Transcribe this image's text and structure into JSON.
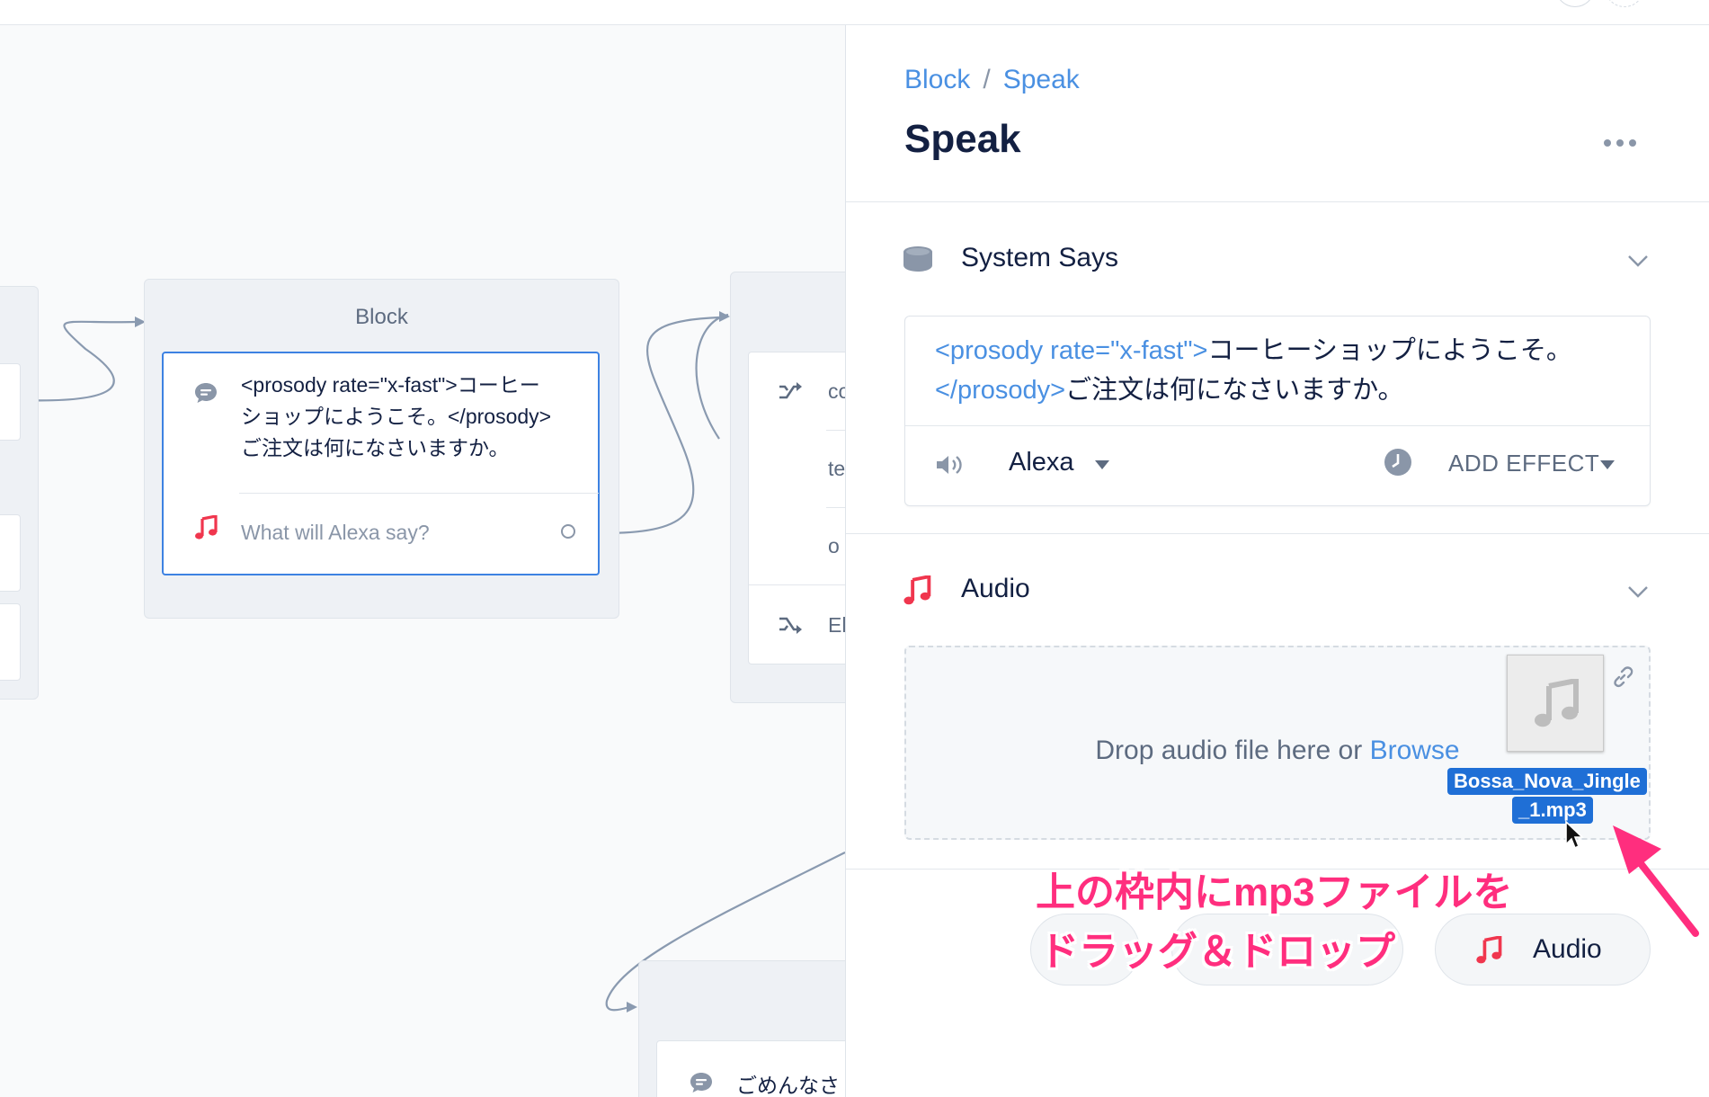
{
  "canvas": {
    "block_node": {
      "title": "Block",
      "speak_text": [
        "<prosody rate=\"x-fast\">コーヒー",
        "ショップにようこそ。</prosody>",
        "ご注文は何になさいますか。"
      ],
      "audio_placeholder": "What will Alexa say?"
    },
    "choice_node": {
      "items": [
        "co",
        "te",
        "o"
      ],
      "else_label": "El"
    },
    "bottom_node": {
      "text": "ごめんなさ"
    }
  },
  "panel": {
    "breadcrumb": [
      "Block",
      "Speak"
    ],
    "title": "Speak",
    "system_says": {
      "title": "System Says",
      "ssml_open": "<prosody rate=\"x-fast\">",
      "text_1": "コーヒーショップにようこそ。",
      "ssml_close": "</prosody>",
      "text_2": "ご注文は何になさいますか。",
      "voice": "Alexa",
      "effect": "ADD EFFECT"
    },
    "audio": {
      "title": "Audio",
      "drop_text": "Drop audio file here or ",
      "browse_link": "Browse"
    },
    "add_buttons": {
      "audio": "Audio"
    }
  },
  "drag": {
    "file_name_line1": "Bossa_Nova_Jingle",
    "file_name_line2": "_1.mp3"
  },
  "annotation": {
    "line1": "上の枠内にmp3ファイルを",
    "line2": "ドラッグ＆ドロップ"
  },
  "colors": {
    "accent": "#4a90e2",
    "audio_icon": "#f0364e",
    "annotation": "#ff2e7e",
    "file_tag": "#1f6fd6"
  }
}
